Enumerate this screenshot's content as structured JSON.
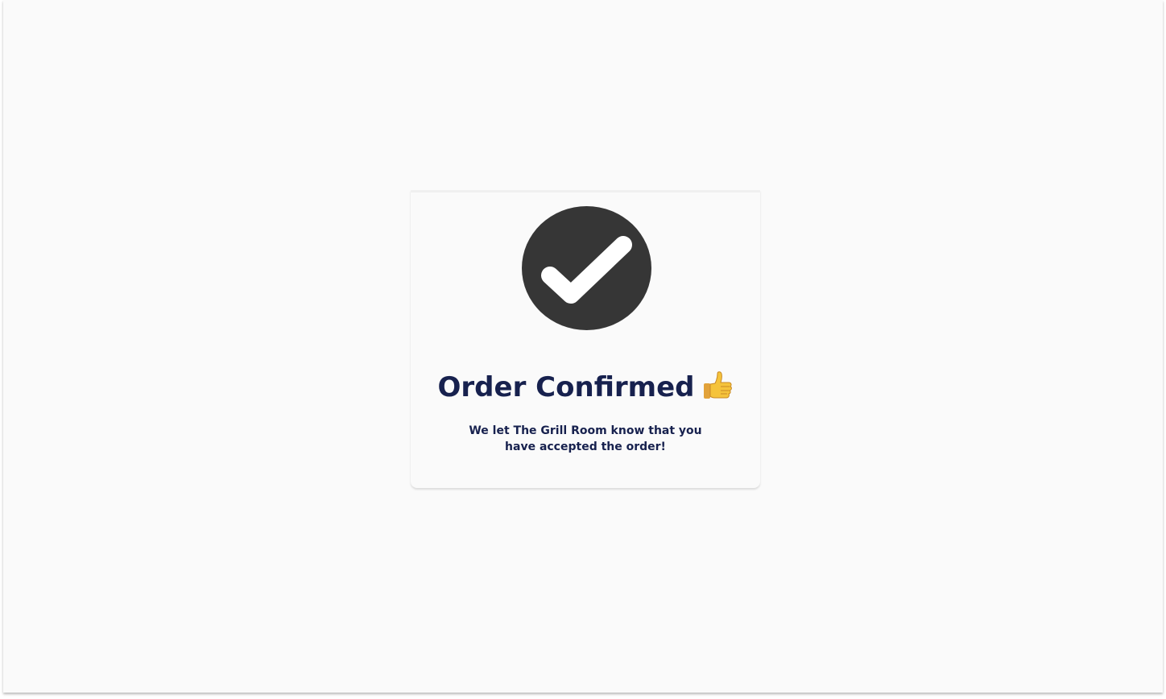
{
  "confirmation": {
    "title": "Order Confirmed",
    "title_emoji_icon": "thumbs-up-icon",
    "status_icon": "check-circle-icon",
    "message": "We let The Grill Room know that you have accepted the order!"
  },
  "colors": {
    "background": "#fafafa",
    "title_text": "#17214e",
    "check_circle": "#363636",
    "check_mark": "#ffffff",
    "thumbs_up": "#f5c33b"
  }
}
